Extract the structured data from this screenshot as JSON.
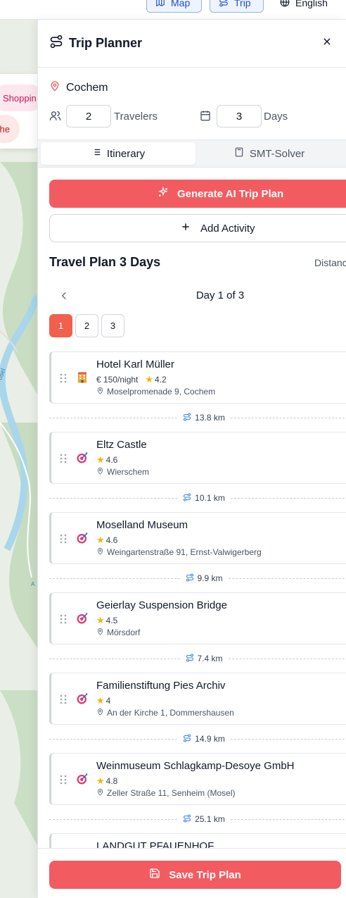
{
  "topbar": {
    "map_label": "Map",
    "trip_label": "Trip",
    "language_label": "English"
  },
  "map_filters": {
    "shopping_label": "Shoppin",
    "second_label": "he"
  },
  "panel": {
    "title": "Trip Planner",
    "destination": "Cochem",
    "travelers_value": "2",
    "travelers_label": "Travelers",
    "days_value": "3",
    "days_label": "Days",
    "tabs": [
      {
        "label": "Itinerary",
        "active": true
      },
      {
        "label": "SMT-Solver",
        "active": false
      }
    ],
    "generate_label": "Generate AI Trip Plan",
    "add_activity_label": "Add Activity",
    "plan_title": "Travel Plan 3 Days",
    "distance_header": "Distanc",
    "day_indicator": "Day 1 of 3",
    "day_pills": [
      "1",
      "2",
      "3"
    ],
    "active_day": "1",
    "stops": [
      {
        "name": "Hotel Karl Müller",
        "type": "hotel",
        "price": "€ 150/night",
        "rating": "4.2",
        "address": "Moselpromenade 9, Cochem",
        "distance_after": "13.8 km"
      },
      {
        "name": "Eltz Castle",
        "type": "attraction",
        "price": "",
        "rating": "4.6",
        "address": "Wierschem",
        "distance_after": "10.1 km"
      },
      {
        "name": "Moselland Museum",
        "type": "attraction",
        "price": "",
        "rating": "4.6",
        "address": "Weingartenstraße 91, Ernst-Valwigerberg",
        "distance_after": "9.9 km"
      },
      {
        "name": "Geierlay Suspension Bridge",
        "type": "attraction",
        "price": "",
        "rating": "4.5",
        "address": "Mörsdorf",
        "distance_after": "7.4 km"
      },
      {
        "name": "Familienstiftung Pies Archiv",
        "type": "attraction",
        "price": "",
        "rating": "4",
        "address": "An der Kirche 1, Dommershausen",
        "distance_after": "14.9 km"
      },
      {
        "name": "Weinmuseum Schlagkamp-Desoye GmbH",
        "type": "attraction",
        "price": "",
        "rating": "4.8",
        "address": "Zeller Straße 11, Senheim (Mosel)",
        "distance_after": "25.1 km"
      },
      {
        "name": "LANDGUT PFAUENHOF",
        "type": "attraction",
        "price": "",
        "rating": "",
        "address": "",
        "distance_after": ""
      }
    ],
    "save_label": "Save Trip Plan"
  },
  "colors": {
    "accent": "#f25c61",
    "active_day": "#f0604d",
    "star": "#f5b301",
    "map_water": "#a9d6ea",
    "map_forest": "#c5dcc0"
  },
  "icons": {
    "map": "map-icon",
    "trip": "route-icon",
    "language": "globe-icon",
    "close": "close-icon",
    "destination": "map-pin-icon",
    "travelers": "users-icon",
    "days": "calendar-icon",
    "itinerary": "list-icon",
    "smt": "calculator-icon",
    "generate": "sparkles-icon",
    "add": "plus-icon",
    "prev": "chevron-left-icon",
    "grip": "grip-vertical-icon",
    "hotel": "hotel-icon",
    "attraction": "target-icon",
    "distance": "route-icon",
    "save": "save-icon"
  }
}
